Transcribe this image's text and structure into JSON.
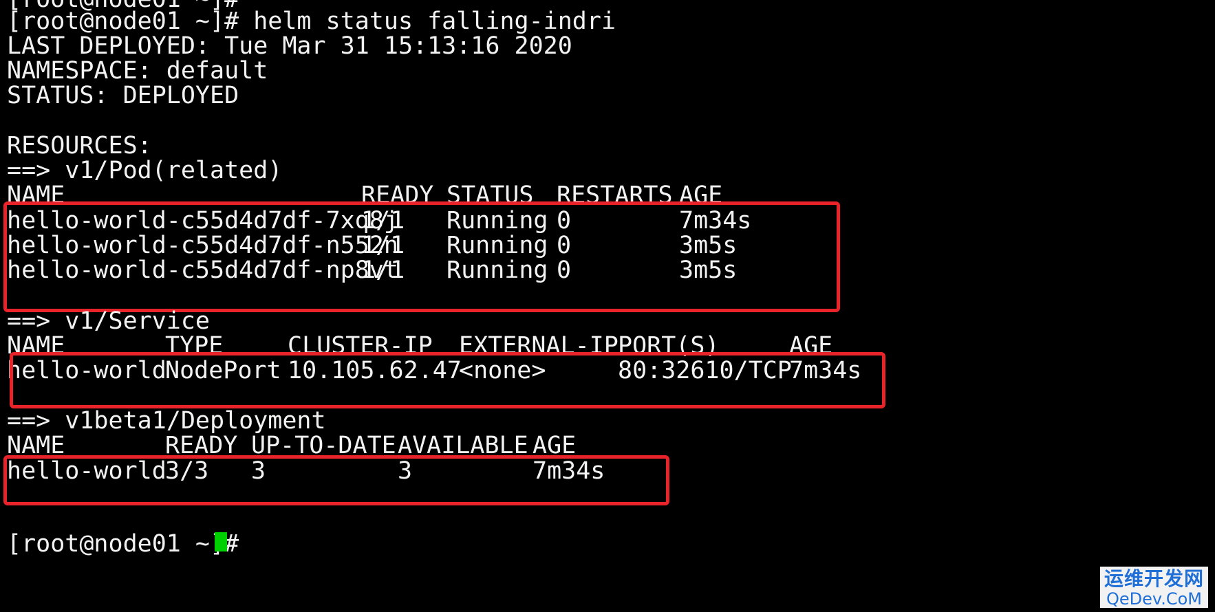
{
  "terminal": {
    "prev_prompt": "[root@node01 ~]#",
    "command_line": "[root@node01 ~]# helm status falling-indri",
    "last_deployed": "LAST DEPLOYED: Tue Mar 31 15:13:16 2020",
    "namespace": "NAMESPACE: default",
    "status": "STATUS: DEPLOYED",
    "resources": "RESOURCES:",
    "final_prompt": "[root@node01 ~]#"
  },
  "pods": {
    "section": "==> v1/Pod(related)",
    "headers": [
      "NAME",
      "READY",
      "STATUS",
      "RESTARTS",
      "AGE"
    ],
    "rows": [
      [
        "hello-world-c55d4d7df-7xq8j",
        "1/1",
        "Running",
        "0",
        "7m34s"
      ],
      [
        "hello-world-c55d4d7df-n552n",
        "1/1",
        "Running",
        "0",
        "3m5s"
      ],
      [
        "hello-world-c55d4d7df-np8vt",
        "1/1",
        "Running",
        "0",
        "3m5s"
      ]
    ]
  },
  "service": {
    "section": "==> v1/Service",
    "headers": [
      "NAME",
      "TYPE",
      "CLUSTER-IP",
      "EXTERNAL-IP",
      "PORT(S)",
      "AGE"
    ],
    "rows": [
      [
        "hello-world",
        "NodePort",
        "10.105.62.47",
        "<none>",
        "80:32610/TCP",
        "7m34s"
      ]
    ]
  },
  "deployment": {
    "section": "==> v1beta1/Deployment",
    "headers": [
      "NAME",
      "READY",
      "UP-TO-DATE",
      "AVAILABLE",
      "AGE"
    ],
    "rows": [
      [
        "hello-world",
        "3/3",
        "3",
        "3",
        "7m34s"
      ]
    ]
  },
  "watermark": {
    "top": "运维开发网",
    "bottom": "QeDev.CoM"
  },
  "colors": {
    "background": "#000000",
    "text": "#f2f2f2",
    "highlight": "#e8232a",
    "cursor": "#00d000",
    "watermark": "#1f6fd6"
  }
}
